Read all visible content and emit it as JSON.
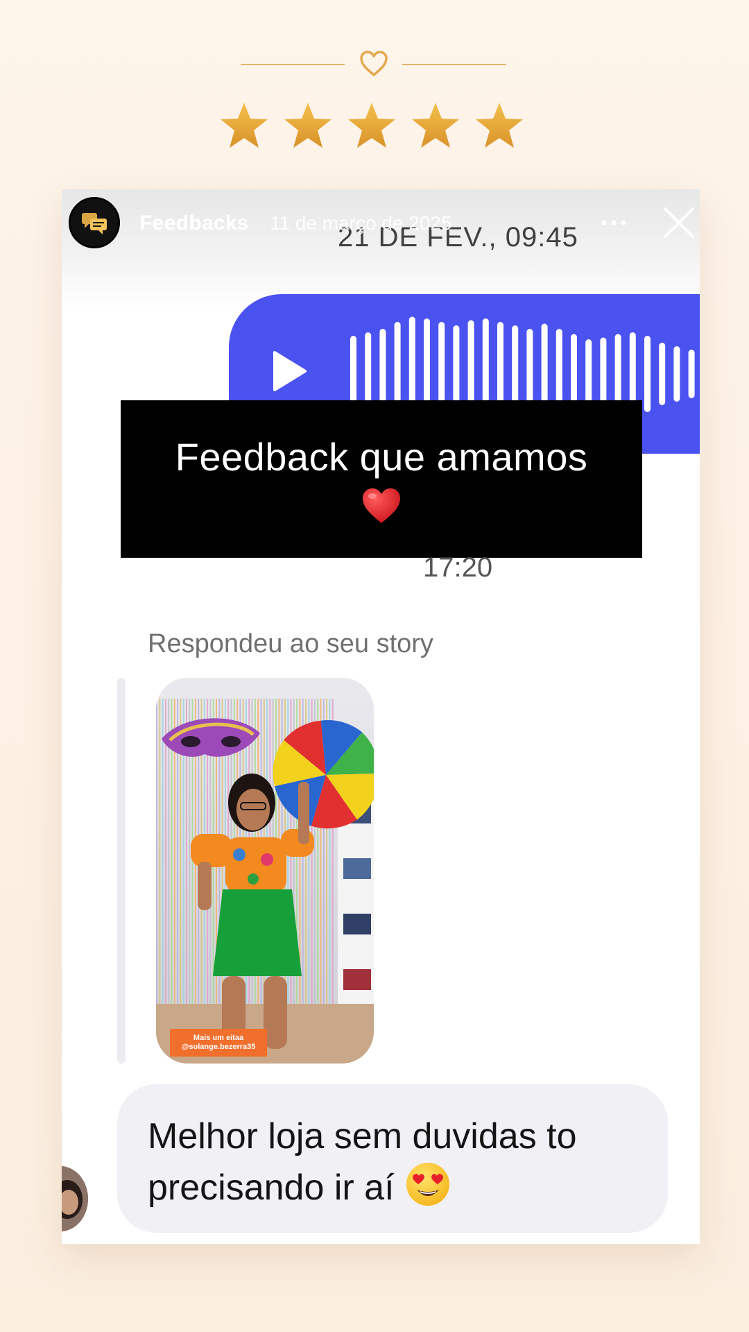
{
  "decor": {
    "heart_icon": "heart-outline-icon",
    "star_icon": "star-icon",
    "rating_stars": 5,
    "accent_color": "#e3b66a",
    "star_color": "#e8a93a"
  },
  "story": {
    "account_name": "Feedbacks",
    "post_date": "11 de março de 2025",
    "more_icon": "more-horizontal-icon",
    "close_icon": "close-icon"
  },
  "chat": {
    "timestamp_top": "21 DE FEV., 09:45",
    "audio_color": "#4a52f0",
    "caption_line1": "Feedback que amamos",
    "caption_emoji_icon": "red-heart-icon",
    "timestamp_mid": "17:20",
    "reply_label": "Respondeu ao seu story",
    "thumb_caption_line1": "Mais um eitaa",
    "thumb_caption_line2": "@solange.bezerra35",
    "message_text": "Melhor loja sem duvidas to precisando ir aí",
    "message_emoji_icon": "heart-eyes-emoji-icon"
  }
}
